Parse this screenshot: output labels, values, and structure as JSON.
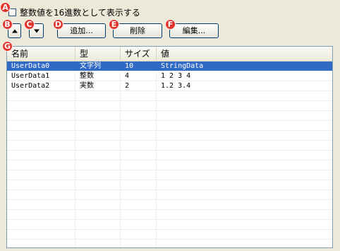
{
  "checkbox": {
    "label": "整数値を16進数として表示する",
    "checked": false
  },
  "buttons": {
    "add": "追加...",
    "delete": "削除",
    "edit": "編集..."
  },
  "callouts": [
    "A",
    "B",
    "C",
    "D",
    "E",
    "F",
    "G"
  ],
  "table": {
    "columns": [
      "名前",
      "型",
      "サイズ",
      "値"
    ],
    "rows": [
      {
        "name": "UserData0",
        "type": "文字列",
        "size": "10",
        "value": "StringData",
        "selected": true
      },
      {
        "name": "UserData1",
        "type": "整数",
        "size": "4",
        "value": "1 2 3 4",
        "selected": false
      },
      {
        "name": "UserData2",
        "type": "実数",
        "size": "2",
        "value": "1.2 3.4",
        "selected": false
      }
    ]
  },
  "colors": {
    "selection": "#316ac5",
    "callout": "#e2342b",
    "window_bg": "#ece9d8"
  },
  "icons": {
    "move_up": "triangle-up-icon",
    "move_down": "triangle-down-icon"
  }
}
